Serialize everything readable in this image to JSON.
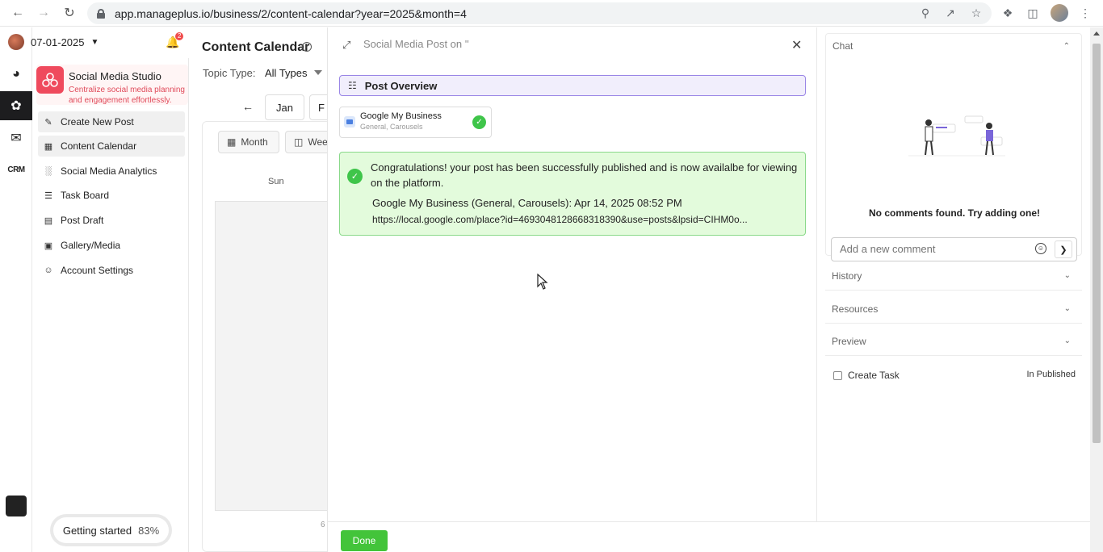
{
  "browser": {
    "url": "app.manageplus.io/business/2/content-calendar?year=2025&month=4"
  },
  "header": {
    "date": "07-01-2025",
    "notification_count": "2"
  },
  "studio": {
    "title": "Social Media Studio",
    "subtitle": "Centralize social media planning and engagement effortlessly."
  },
  "sidebar": {
    "items": [
      {
        "label": "Create New Post",
        "icon": "edit-icon"
      },
      {
        "label": "Content Calendar",
        "icon": "calendar-icon"
      },
      {
        "label": "Social Media Analytics",
        "icon": "bar-chart-icon"
      },
      {
        "label": "Task Board",
        "icon": "list-icon"
      },
      {
        "label": "Post Draft",
        "icon": "document-icon"
      },
      {
        "label": "Gallery/Media",
        "icon": "image-icon"
      },
      {
        "label": "Account Settings",
        "icon": "user-icon"
      }
    ]
  },
  "getting_started": {
    "label": "Getting started",
    "percent": "83%"
  },
  "calendar": {
    "title": "Content Calendar",
    "topic_label": "Topic Type:",
    "topic_value": "All Types",
    "months": [
      "Jan",
      "F"
    ],
    "views": [
      "Month",
      "Wee"
    ],
    "day_header": "Sun",
    "cell_number": "6"
  },
  "modal": {
    "title": "Social Media Post on ''",
    "overview_label": "Post Overview",
    "platform_card": {
      "name": "Google My Business",
      "sub": "General, Carousels"
    },
    "success": {
      "message": "Congratulations! your post has been successfully published and is now availalbe for viewing on the platform.",
      "platform_line": "Google My Business (General, Carousels): Apr 14, 2025 08:52 PM",
      "link": "https://local.google.com/place?id=4693048128668318390&use=posts&lpsid=CIHM0o..."
    },
    "done_label": "Done"
  },
  "right_panel": {
    "chat_title": "Chat",
    "no_comments": "No comments found. Try adding one!",
    "comment_placeholder": "Add a new comment",
    "sections": [
      "History",
      "Resources",
      "Preview"
    ],
    "create_task_label": "Create Task",
    "status": "In Published"
  },
  "colors": {
    "accent_purple": "#9a86e6",
    "success_green": "#3fc54a",
    "brand_red": "#ef4a5d"
  }
}
